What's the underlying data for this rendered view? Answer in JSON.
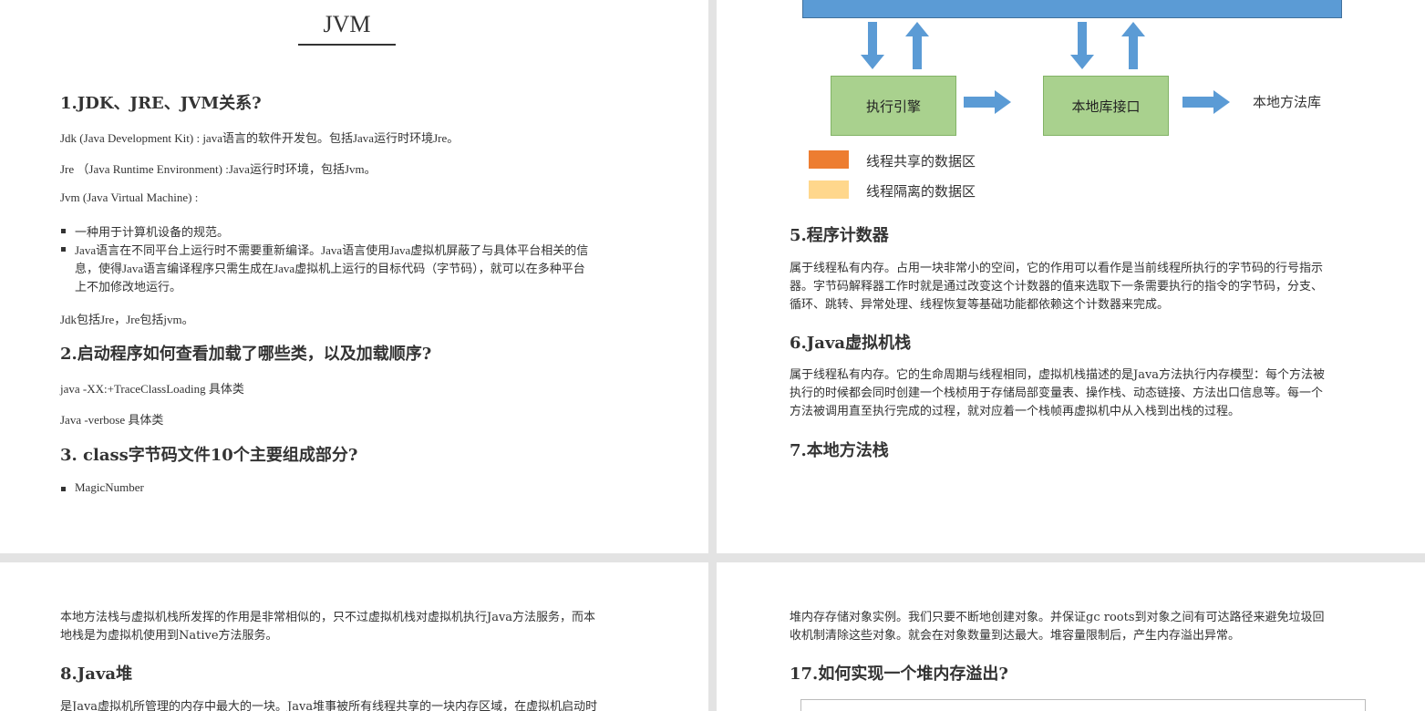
{
  "page1": {
    "title": "JVM",
    "h1": "1.JDK、JRE、JVM关系?",
    "p_jdk": "Jdk (Java Development Kit) : java语言的软件开发包。包括Java运行时环境Jre。",
    "p_jre": "Jre （Java Runtime Environment) :Java运行时环境，包括Jvm。",
    "p_jvm": "Jvm (Java Virtual Machine) :",
    "bullets": [
      "一种用于计算机设备的规范。",
      "Java语言在不同平台上运行时不需要重新编译。Java语言使用Java虚拟机屏蔽了与具体平台相关的信",
      "息，使得Java语言编译程序只需生成在Java虚拟机上运行的目标代码（字节码），就可以在多种平台",
      "上不加修改地运行。"
    ],
    "p_rel": "Jdk包括Jre，Jre包括jvm。",
    "h2": "2.启动程序如何查看加载了哪些类，以及加载顺序?",
    "cmd1": "java -XX:+TraceClassLoading  具体类",
    "cmd2": "Java -verbose 具体类",
    "h3": "3. class字节码文件10个主要组成部分?",
    "bullet_magic": "MagicNumber"
  },
  "page2": {
    "diagram": {
      "exec_engine": "执行引擎",
      "native_iface": "本地库接口",
      "native_lib": "本地方法库",
      "legend_shared": "线程共享的数据区",
      "legend_isolated": "线程隔离的数据区",
      "colors": {
        "bar": "#5b9bd5",
        "box": "#a9d18e",
        "shared": "#ed7d31",
        "isolated": "#ffd78c"
      }
    },
    "h5": "5.程序计数器",
    "p5": [
      "属于线程私有内存。占用一块非常小的空间，它的作用可以看作是当前线程所执行的字节码的行号指示",
      "器。字节码解释器工作时就是通过改变这个计数器的值来选取下一条需要执行的指令的字节码，分支、",
      "循环、跳转、异常处理、线程恢复等基础功能都依赖这个计数器来完成。"
    ],
    "h6": "6.Java虚拟机栈",
    "p6": [
      "属于线程私有内存。它的生命周期与线程相同，虚拟机栈描述的是Java方法执行内存模型：每个方法被",
      "执行的时候都会同时创建一个栈桢用于存储局部变量表、操作栈、动态链接、方法出口信息等。每一个",
      "方法被调用直至执行完成的过程，就对应着一个栈帧再虚拟机中从入栈到出栈的过程。"
    ],
    "h7": "7.本地方法栈"
  },
  "page3": {
    "p": [
      "本地方法栈与虚拟机栈所发挥的作用是非常相似的，只不过虚拟机栈对虚拟机执行Java方法服务，而本",
      "地栈是为虚拟机使用到Native方法服务。"
    ],
    "h8": "8.Java堆",
    "p8_cut": "是Java虚拟机所管理的内存中最大的一块。Java堆事被所有线程共享的一块内存区域，在虚拟机启动时"
  },
  "page4": {
    "p": [
      "堆内存存储对象实例。我们只要不断地创建对象。并保证gc roots到对象之间有可达路径来避免垃圾回",
      "收机制清除这些对象。就会在对象数量到达最大。堆容量限制后，产生内存溢出异常。"
    ],
    "h17": "17.如何实现一个堆内存溢出?"
  }
}
